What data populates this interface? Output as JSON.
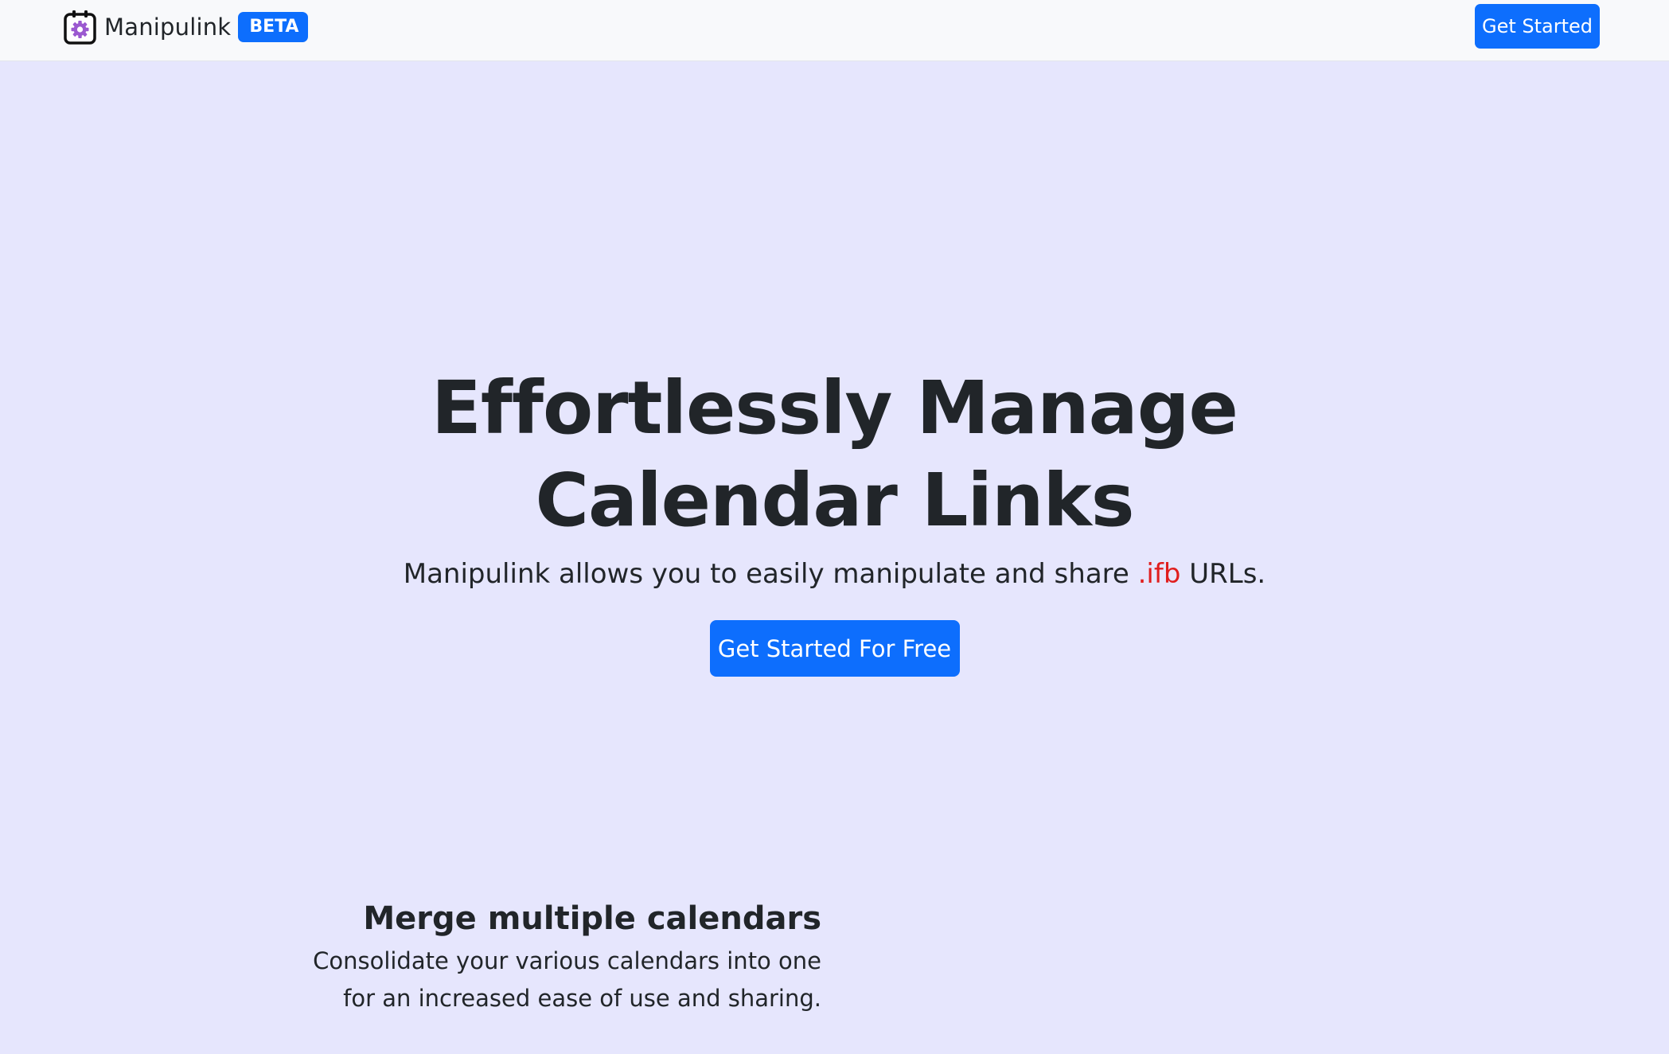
{
  "navbar": {
    "brand_name": "Manipulink",
    "badge": "BETA",
    "cta_label": "Get Started",
    "logo_icon": "calendar-gear-icon"
  },
  "hero": {
    "title_line1": "Effortlessly Manage",
    "title_line2": "Calendar Links",
    "subtitle_before": "Manipulink allows you to easily manipulate and share",
    "subtitle_ext": ".ifb",
    "subtitle_after": "URLs.",
    "cta_label": "Get Started For Free"
  },
  "feature": {
    "title": "Merge multiple calendars",
    "text_line1": "Consolidate your various calendars into one",
    "text_line2": "for an increased ease of use and sharing."
  },
  "colors": {
    "background": "#e6e6fd",
    "navbar_bg": "#f8f9fb",
    "primary": "#0d6efd",
    "extension_highlight": "#e01e1e",
    "text": "#212529",
    "logo_gear": "#9b59d0"
  }
}
